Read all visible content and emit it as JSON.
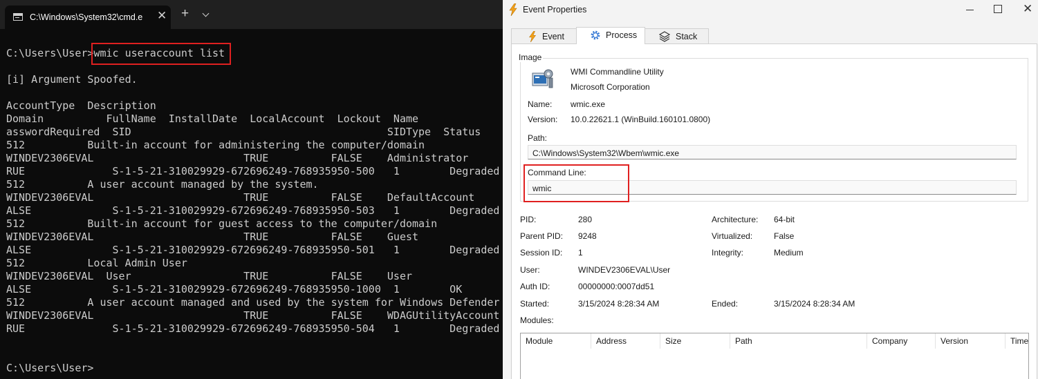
{
  "terminal": {
    "tab_title": "C:\\Windows\\System32\\cmd.e",
    "tab_close_glyph": "✕",
    "new_tab_glyph": "+",
    "lines": [
      "C:\\Users\\User>wmic useraccount list",
      "",
      "[i] Argument Spoofed.",
      "",
      "AccountType  Description",
      "Domain          FullName  InstallDate  LocalAccount  Lockout  Name",
      "asswordRequired  SID                                         SIDType  Status",
      "512          Built-in account for administering the computer/domain",
      "WINDEV2306EVAL                        TRUE          FALSE    Administrator",
      "RUE              S-1-5-21-310029929-672696249-768935950-500   1        Degraded",
      "512          A user account managed by the system.",
      "WINDEV2306EVAL                        TRUE          FALSE    DefaultAccount",
      "ALSE             S-1-5-21-310029929-672696249-768935950-503   1        Degraded",
      "512          Built-in account for guest access to the computer/domain",
      "WINDEV2306EVAL                        TRUE          FALSE    Guest",
      "ALSE             S-1-5-21-310029929-672696249-768935950-501   1        Degraded",
      "512          Local Admin User",
      "WINDEV2306EVAL  User                  TRUE          FALSE    User",
      "ALSE             S-1-5-21-310029929-672696249-768935950-1000  1        OK",
      "512          A user account managed and used by the system for Windows Defender",
      "WINDEV2306EVAL                        TRUE          FALSE    WDAGUtilityAccount",
      "RUE              S-1-5-21-310029929-672696249-768935950-504   1        Degraded",
      "",
      "",
      "C:\\Users\\User>"
    ]
  },
  "event_properties": {
    "title": "Event Properties",
    "close_glyph": "✕",
    "tabs": [
      {
        "label": "Event",
        "icon": "bolt-icon",
        "active": false
      },
      {
        "label": "Process",
        "icon": "gear-icon",
        "active": true
      },
      {
        "label": "Stack",
        "icon": "stack-icon",
        "active": false
      }
    ],
    "image": {
      "legend": "Image",
      "description": "WMI Commandline Utility",
      "company": "Microsoft Corporation",
      "name_label": "Name:",
      "name": "wmic.exe",
      "version_label": "Version:",
      "version": "10.0.22621.1 (WinBuild.160101.0800)",
      "path_label": "Path:",
      "path": "C:\\Windows\\System32\\Wbem\\wmic.exe",
      "command_line_label": "Command Line:",
      "command_line": "wmic"
    },
    "details": {
      "pid_label": "PID:",
      "pid": "280",
      "parent_pid_label": "Parent PID:",
      "parent_pid": "9248",
      "session_id_label": "Session ID:",
      "session_id": "1",
      "user_label": "User:",
      "user": "WINDEV2306EVAL\\User",
      "auth_id_label": "Auth ID:",
      "auth_id": "00000000:0007dd51",
      "started_label": "Started:",
      "started": "3/15/2024 8:28:34 AM",
      "architecture_label": "Architecture:",
      "architecture": "64-bit",
      "virtualized_label": "Virtualized:",
      "virtualized": "False",
      "integrity_label": "Integrity:",
      "integrity": "Medium",
      "ended_label": "Ended:",
      "ended": "3/15/2024 8:28:34 AM"
    },
    "modules": {
      "label": "Modules:",
      "columns": [
        "Module",
        "Address",
        "Size",
        "Path",
        "Company",
        "Version",
        "Time"
      ]
    },
    "colors": {
      "highlight": "#e02020",
      "bolt": "#f4a21a"
    }
  }
}
